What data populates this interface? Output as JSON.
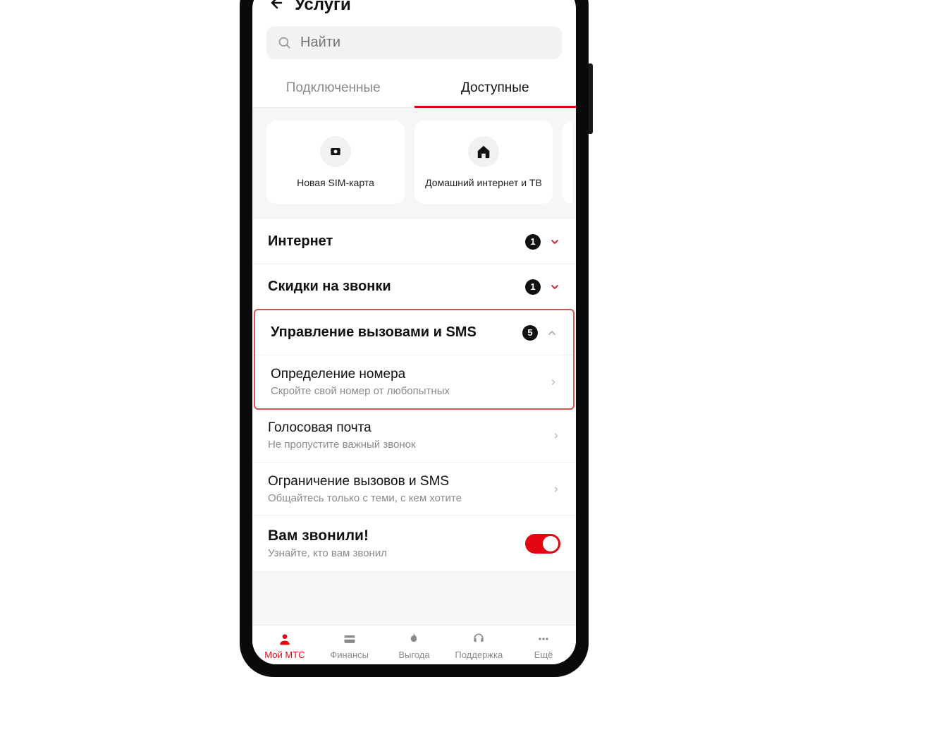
{
  "header": {
    "title": "Услуги"
  },
  "search": {
    "placeholder": "Найти"
  },
  "tabs": {
    "connected": "Подключенные",
    "available": "Доступные"
  },
  "cards": {
    "sim": "Новая SIM-карта",
    "home": "Домашний интернет и ТВ"
  },
  "categories": {
    "internet": {
      "title": "Интернет",
      "count": "1"
    },
    "discounts": {
      "title": "Скидки на звонки",
      "count": "1"
    },
    "calls_sms": {
      "title": "Управление вызовами и SMS",
      "count": "5"
    }
  },
  "items": {
    "caller_id": {
      "title": "Определение номера",
      "desc": "Скройте свой номер от любопытных"
    },
    "voicemail": {
      "title": "Голосовая почта",
      "desc": "Не пропустите важный звонок"
    },
    "restrict": {
      "title": "Ограничение вызовов и SMS",
      "desc": "Общайтесь только с теми, с кем хотите"
    },
    "you_called": {
      "title": "Вам звонили!",
      "desc": "Узнайте, кто вам звонил"
    }
  },
  "nav": {
    "my_mts": "Мой МТС",
    "finance": "Финансы",
    "benefit": "Выгода",
    "support": "Поддержка",
    "more": "Ещё"
  },
  "colors": {
    "accent": "#e30611"
  }
}
